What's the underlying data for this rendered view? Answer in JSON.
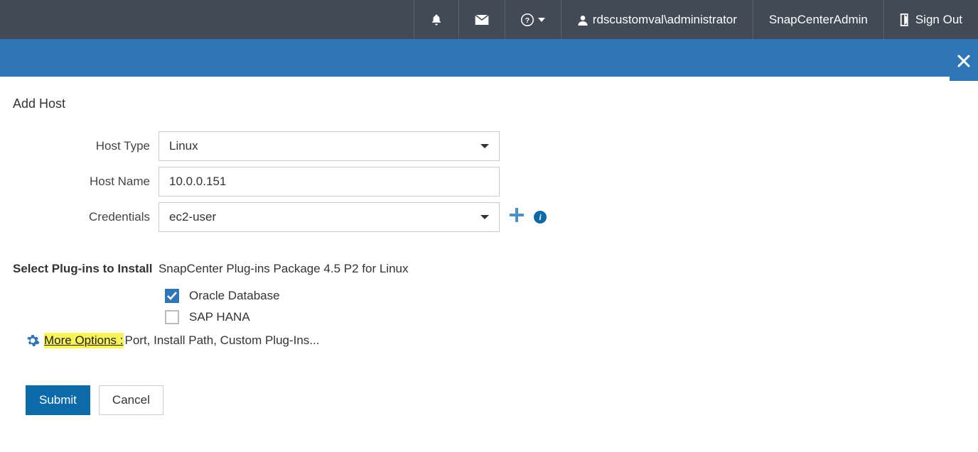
{
  "header": {
    "user_label": "rdscustomval\\administrator",
    "role_label": "SnapCenterAdmin",
    "signout_label": "Sign Out"
  },
  "page": {
    "title": "Add Host"
  },
  "form": {
    "host_type": {
      "label": "Host Type",
      "value": "Linux"
    },
    "host_name": {
      "label": "Host Name",
      "value": "10.0.0.151"
    },
    "credentials": {
      "label": "Credentials",
      "value": "ec2-user"
    }
  },
  "plugins": {
    "label_bold": "Select Plug-ins to Install",
    "label_rest": "SnapCenter Plug-ins Package 4.5 P2 for Linux",
    "items": [
      {
        "label": "Oracle Database",
        "checked": true
      },
      {
        "label": "SAP HANA",
        "checked": false
      }
    ]
  },
  "more_options": {
    "link": "More Options :",
    "desc": " Port, Install Path, Custom Plug-Ins..."
  },
  "buttons": {
    "submit": "Submit",
    "cancel": "Cancel"
  }
}
